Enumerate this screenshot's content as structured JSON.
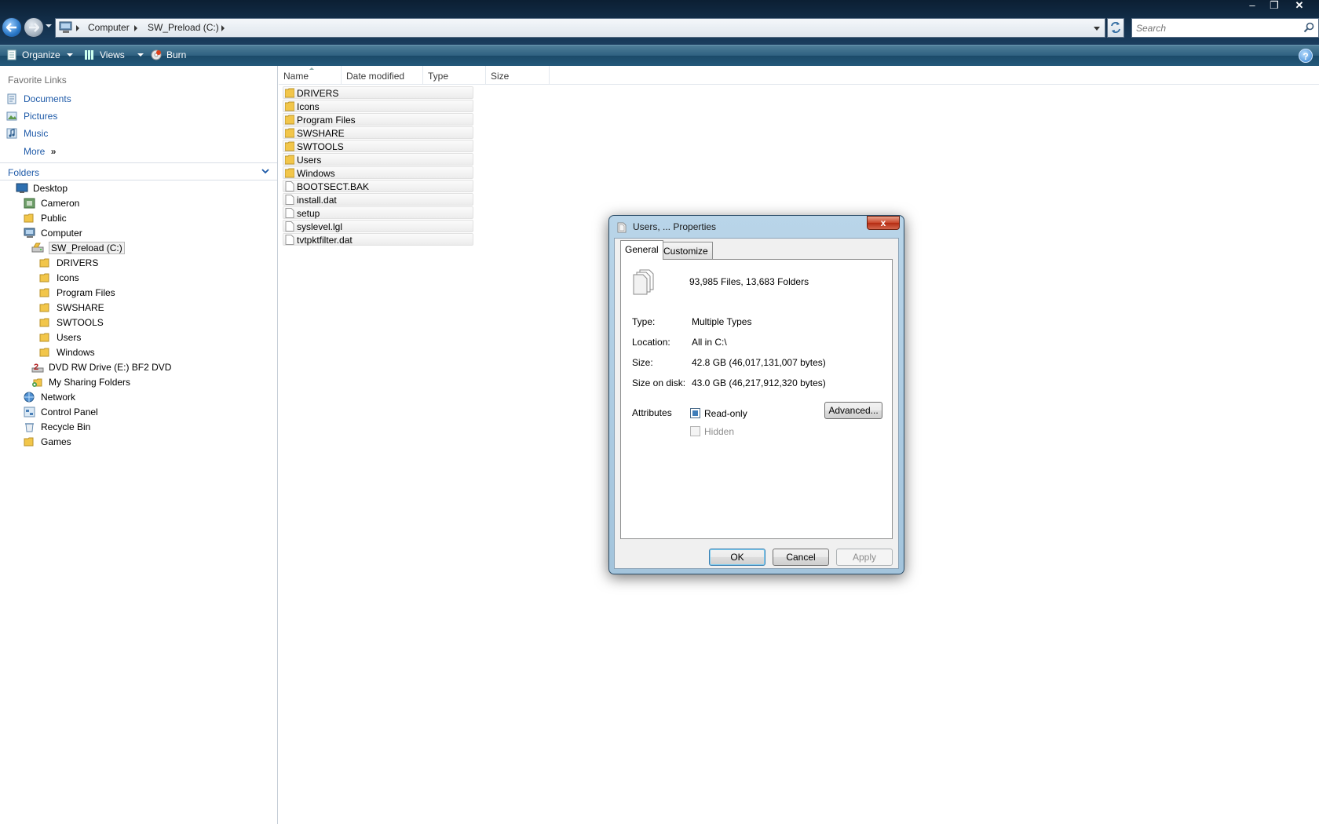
{
  "window": {
    "controls": [
      "minimize",
      "maximize",
      "close"
    ]
  },
  "address_bar": {
    "crumbs": [
      "Computer",
      "SW_Preload (C:)"
    ],
    "search_placeholder": "Search"
  },
  "command_bar": {
    "organize_label": "Organize",
    "views_label": "Views",
    "burn_label": "Burn",
    "help_label": "?"
  },
  "nav_pane": {
    "favorites_title": "Favorite Links",
    "favorites": [
      {
        "label": "Documents",
        "icon": "documents-icon"
      },
      {
        "label": "Pictures",
        "icon": "pictures-icon"
      },
      {
        "label": "Music",
        "icon": "music-icon"
      }
    ],
    "more_label": "More",
    "folders_label": "Folders",
    "tree": [
      {
        "label": "Desktop",
        "icon": "desktop-icon",
        "depth": 0
      },
      {
        "label": "Cameron",
        "icon": "user-folder-icon",
        "depth": 1
      },
      {
        "label": "Public",
        "icon": "folder-icon",
        "depth": 1
      },
      {
        "label": "Computer",
        "icon": "computer-icon",
        "depth": 1
      },
      {
        "label": "SW_Preload (C:)",
        "icon": "drive-icon",
        "depth": 2,
        "selected": true
      },
      {
        "label": "DRIVERS",
        "icon": "folder-icon",
        "depth": 3
      },
      {
        "label": "Icons",
        "icon": "folder-icon",
        "depth": 3
      },
      {
        "label": "Program Files",
        "icon": "folder-icon",
        "depth": 3
      },
      {
        "label": "SWSHARE",
        "icon": "folder-icon",
        "depth": 3
      },
      {
        "label": "SWTOOLS",
        "icon": "folder-icon",
        "depth": 3
      },
      {
        "label": "Users",
        "icon": "folder-icon",
        "depth": 3
      },
      {
        "label": "Windows",
        "icon": "folder-icon",
        "depth": 3
      },
      {
        "label": "DVD RW Drive (E:) BF2 DVD",
        "icon": "dvd-icon",
        "depth": 2
      },
      {
        "label": "My Sharing Folders",
        "icon": "sharing-icon",
        "depth": 2
      },
      {
        "label": "Network",
        "icon": "network-icon",
        "depth": 1
      },
      {
        "label": "Control Panel",
        "icon": "control-panel-icon",
        "depth": 1
      },
      {
        "label": "Recycle Bin",
        "icon": "recycle-bin-icon",
        "depth": 1
      },
      {
        "label": "Games",
        "icon": "folder-icon",
        "depth": 1
      }
    ]
  },
  "file_list": {
    "columns": [
      "Name",
      "Date modified",
      "Type",
      "Size"
    ],
    "items": [
      {
        "name": "DRIVERS",
        "kind": "folder"
      },
      {
        "name": "Icons",
        "kind": "folder"
      },
      {
        "name": "Program Files",
        "kind": "folder"
      },
      {
        "name": "SWSHARE",
        "kind": "folder"
      },
      {
        "name": "SWTOOLS",
        "kind": "folder"
      },
      {
        "name": "Users",
        "kind": "folder"
      },
      {
        "name": "Windows",
        "kind": "folder"
      },
      {
        "name": "BOOTSECT.BAK",
        "kind": "file"
      },
      {
        "name": "install.dat",
        "kind": "file"
      },
      {
        "name": "setup",
        "kind": "file"
      },
      {
        "name": "syslevel.lgl",
        "kind": "file"
      },
      {
        "name": "tvtpktfilter.dat",
        "kind": "file"
      }
    ]
  },
  "dialog": {
    "title": "Users, ... Properties",
    "close_label": "x",
    "tabs": [
      "General",
      "Customize"
    ],
    "count_text": "93,985 Files, 13,683 Folders",
    "type_label": "Type:",
    "type_value": "Multiple Types",
    "location_label": "Location:",
    "location_value": "All in C:\\",
    "size_label": "Size:",
    "size_value": "42.8 GB (46,017,131,007 bytes)",
    "size_on_disk_label": "Size on disk:",
    "size_on_disk_value": "43.0 GB (46,217,912,320 bytes)",
    "attributes_label": "Attributes",
    "readonly_label": "Read-only",
    "readonly_state": "indeterminate",
    "hidden_label": "Hidden",
    "hidden_state": "disabled",
    "advanced_label": "Advanced...",
    "ok_label": "OK",
    "cancel_label": "Cancel",
    "apply_label": "Apply"
  },
  "colors": {
    "titlebar": "#14324f",
    "command_bar": "#2e6080",
    "link_blue": "#1e5aa8",
    "folder_yellow": "#f2c64a"
  }
}
